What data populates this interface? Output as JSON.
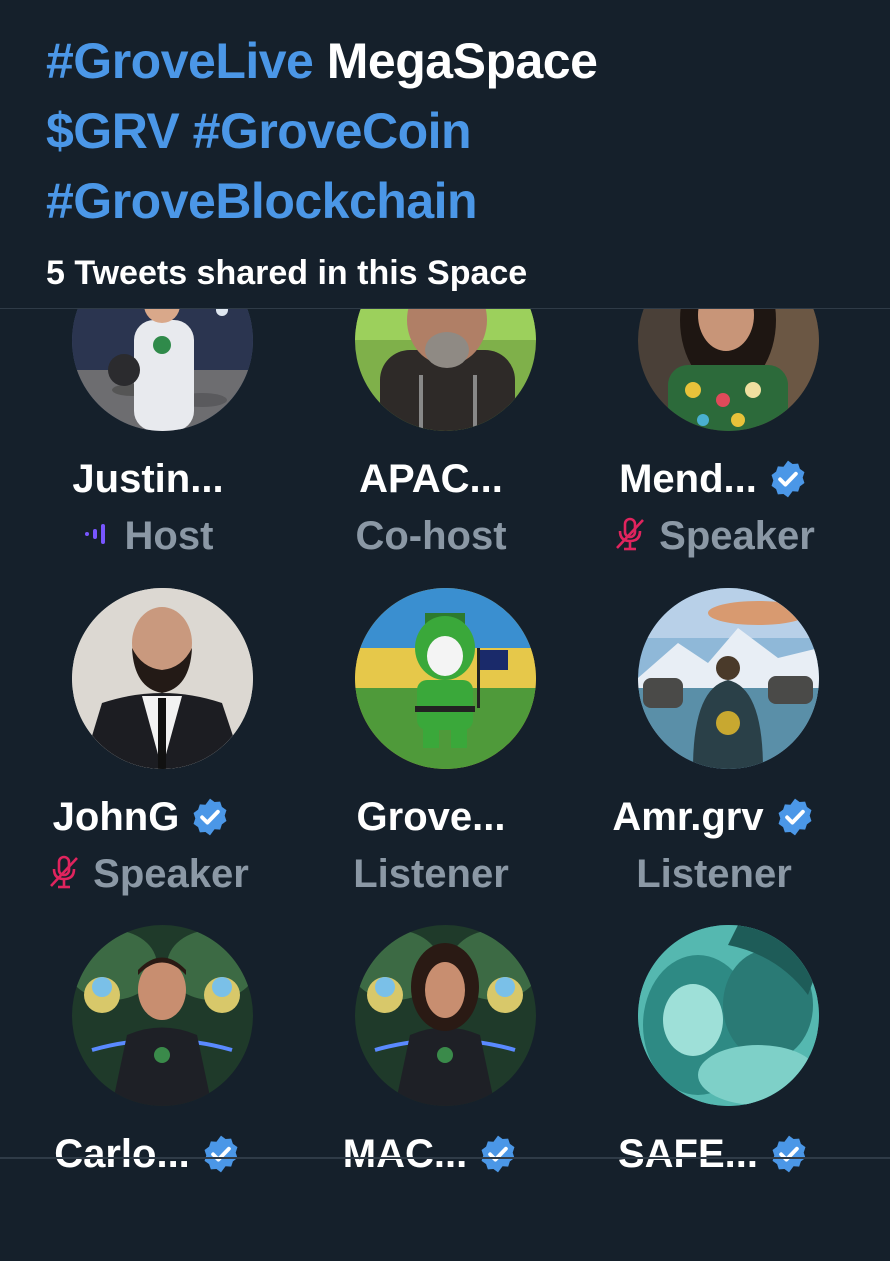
{
  "space": {
    "title_tag1": "#GroveLive",
    "title_plain": "MegaSpace",
    "title_line2": "$GRV #GroveCoin",
    "title_line3": "#GroveBlockchain",
    "shared_text": "5 Tweets shared in this Space"
  },
  "colors": {
    "background": "#15202b",
    "accent": "#4b97e7",
    "muted": "#8b98a5",
    "mute_icon": "#e0245e",
    "host_icon": "#7856ff"
  },
  "participants": [
    {
      "name": "Justin...",
      "role": "Host",
      "verified": false,
      "role_icon": "audio-bars-icon"
    },
    {
      "name": "APAC...",
      "role": "Co-host",
      "verified": false,
      "role_icon": ""
    },
    {
      "name": "Mend...",
      "role": "Speaker",
      "verified": true,
      "role_icon": "mic-muted-icon"
    },
    {
      "name": "JohnG",
      "role": "Speaker",
      "verified": true,
      "role_icon": "mic-muted-icon"
    },
    {
      "name": "Grove...",
      "role": "Listener",
      "verified": false,
      "role_icon": ""
    },
    {
      "name": "Amr.grv",
      "role": "Listener",
      "verified": true,
      "role_icon": ""
    },
    {
      "name": "Carlo...",
      "role": "",
      "verified": true,
      "role_icon": ""
    },
    {
      "name": "MAC...",
      "role": "",
      "verified": true,
      "role_icon": ""
    },
    {
      "name": "SAFE...",
      "role": "",
      "verified": true,
      "role_icon": ""
    }
  ]
}
